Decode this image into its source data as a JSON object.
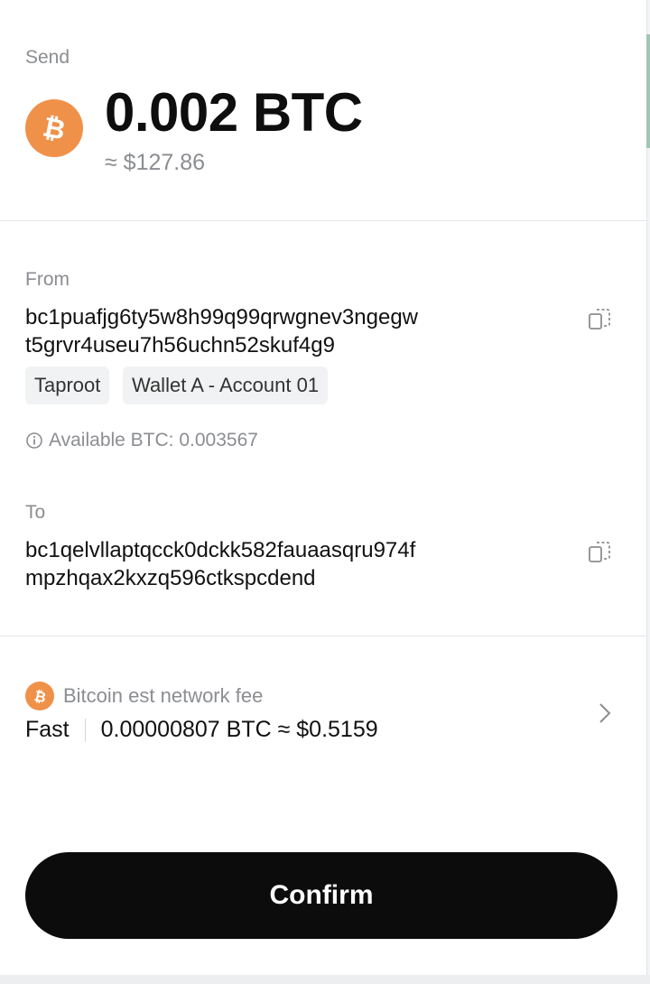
{
  "send": {
    "label": "Send",
    "amount": "0.002 BTC",
    "fiat": "≈ $127.86",
    "asset_icon": "bitcoin-icon",
    "asset_color": "#f0914a"
  },
  "from": {
    "label": "From",
    "address_line1": "bc1puafjg6ty5w8h99q99qrwgnev3ngegw",
    "address_line2": "t5grvr4useu7h56uchn52skuf4g9",
    "tags": [
      "Taproot",
      "Wallet A - Account 01"
    ],
    "available": "Available BTC: 0.003567"
  },
  "to": {
    "label": "To",
    "address_line1": "bc1qelvllaptqcck0dckk582fauaasqru974f",
    "address_line2": "mpzhqax2kxzq596ctkspcdend"
  },
  "fee": {
    "label": "Bitcoin est network fee",
    "speed": "Fast",
    "value": "0.00000807 BTC ≈ $0.5159"
  },
  "actions": {
    "confirm_label": "Confirm"
  },
  "colors": {
    "accent": "#f0914a",
    "button_bg": "#0c0c0c",
    "muted_text": "#8b8d91"
  }
}
